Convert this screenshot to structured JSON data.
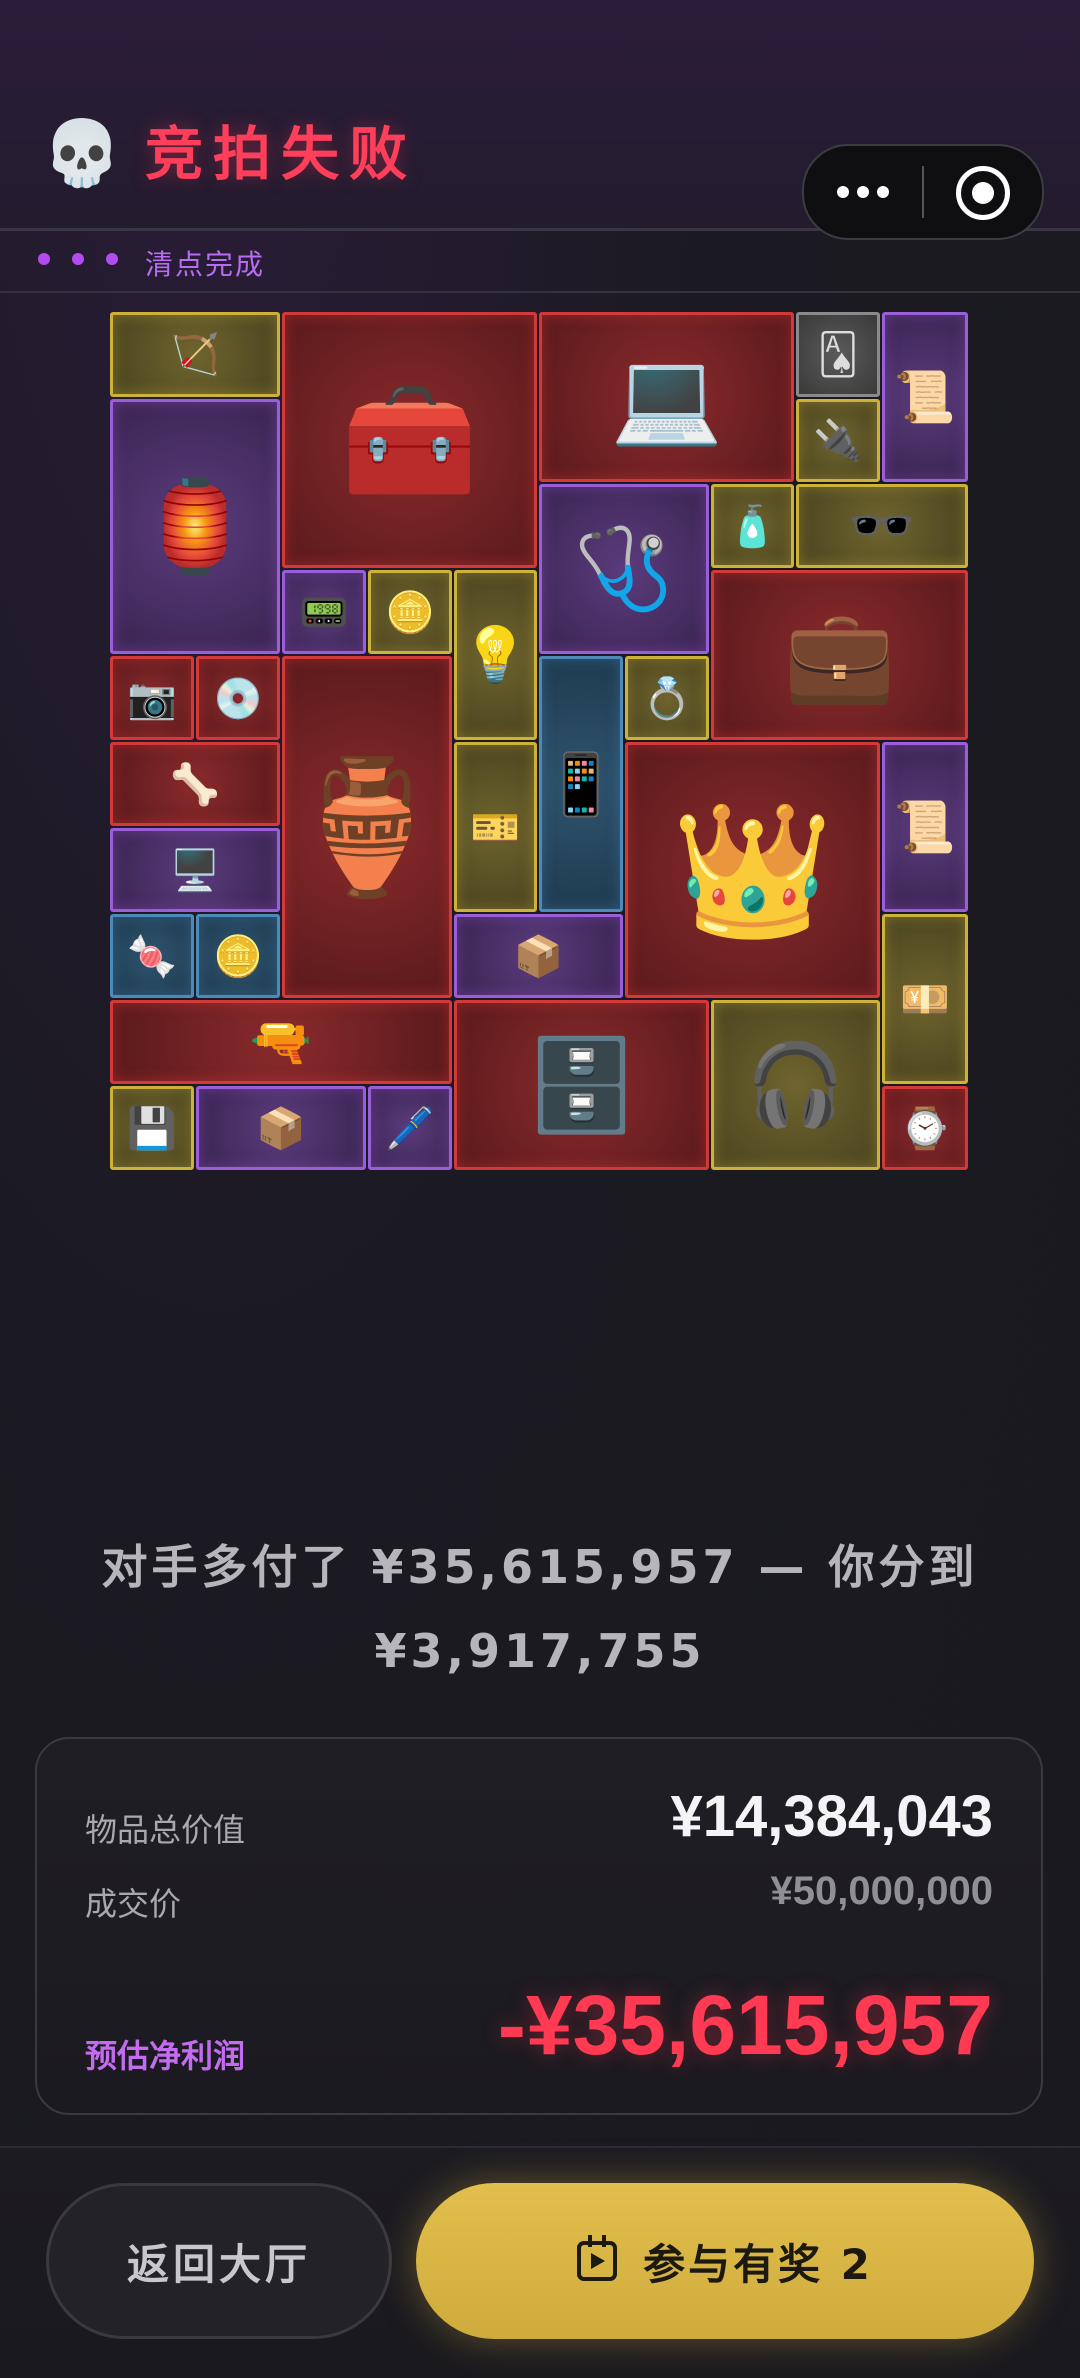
{
  "header": {
    "title": "竞拍失败",
    "skull_icon": "💀"
  },
  "status": {
    "text": "清点完成"
  },
  "items": [
    {
      "name": "crossbow",
      "icon": "🏹",
      "rarity": "yellow"
    },
    {
      "name": "equipment-case",
      "icon": "🧰",
      "rarity": "red"
    },
    {
      "name": "laptop",
      "icon": "💻",
      "rarity": "red"
    },
    {
      "name": "playing-card",
      "icon": "🂡",
      "rarity": "gray"
    },
    {
      "name": "old-book",
      "icon": "📜",
      "rarity": "purple"
    },
    {
      "name": "lamp",
      "icon": "🏮",
      "rarity": "purple"
    },
    {
      "name": "usb-drive",
      "icon": "🔌",
      "rarity": "yellow"
    },
    {
      "name": "blood-pressure-monitor",
      "icon": "🩺",
      "rarity": "purple"
    },
    {
      "name": "inhaler",
      "icon": "🧴",
      "rarity": "yellow"
    },
    {
      "name": "sunglasses",
      "icon": "🕶️",
      "rarity": "yellow"
    },
    {
      "name": "walkie-talkie",
      "icon": "📟",
      "rarity": "purple"
    },
    {
      "name": "jewelry-box",
      "icon": "🪙",
      "rarity": "yellow"
    },
    {
      "name": "uv-lamp",
      "icon": "💡",
      "rarity": "yellow"
    },
    {
      "name": "rugged-laptop",
      "icon": "💼",
      "rarity": "red"
    },
    {
      "name": "camera-module",
      "icon": "📷",
      "rarity": "red"
    },
    {
      "name": "disc",
      "icon": "💿",
      "rarity": "red"
    },
    {
      "name": "vase",
      "icon": "🏺",
      "rarity": "red"
    },
    {
      "name": "phone-device",
      "icon": "📱",
      "rarity": "blue"
    },
    {
      "name": "gold-ring",
      "icon": "💍",
      "rarity": "yellow"
    },
    {
      "name": "crown",
      "icon": "👑",
      "rarity": "red"
    },
    {
      "name": "old-book-2",
      "icon": "📜",
      "rarity": "purple"
    },
    {
      "name": "claw",
      "icon": "🦴",
      "rarity": "red"
    },
    {
      "name": "tickets",
      "icon": "🎫",
      "rarity": "yellow"
    },
    {
      "name": "graphics-card",
      "icon": "🖥️",
      "rarity": "purple"
    },
    {
      "name": "banknotes",
      "icon": "💴",
      "rarity": "yellow"
    },
    {
      "name": "candy",
      "icon": "🍬",
      "rarity": "blue"
    },
    {
      "name": "coin",
      "icon": "🪙",
      "rarity": "blue"
    },
    {
      "name": "tape-box",
      "icon": "📦",
      "rarity": "purple"
    },
    {
      "name": "rifle",
      "icon": "🔫",
      "rarity": "red"
    },
    {
      "name": "nas-server",
      "icon": "🗄️",
      "rarity": "red"
    },
    {
      "name": "headset",
      "icon": "🎧",
      "rarity": "yellow"
    },
    {
      "name": "floppy-disk",
      "icon": "💾",
      "rarity": "yellow"
    },
    {
      "name": "tape-box-2",
      "icon": "📦",
      "rarity": "purple"
    },
    {
      "name": "pen",
      "icon": "🖊️",
      "rarity": "purple"
    },
    {
      "name": "gold-watch",
      "icon": "⌚",
      "rarity": "red"
    }
  ],
  "summary": {
    "line1": "对手多付了 ¥35,615,957 — 你分到",
    "line2": "¥3,917,755"
  },
  "card": {
    "total_label": "物品总价值",
    "total_value": "¥14,384,043",
    "deal_label": "成交价",
    "deal_value": "¥50,000,000",
    "profit_label": "预估净利润",
    "profit_value": "-¥35,615,957"
  },
  "buttons": {
    "back": "返回大厅",
    "join": "参与有奖 2"
  },
  "colors": {
    "accent_red": "#ff3a52",
    "accent_purple": "#c46cf0",
    "accent_gold": "#d6b446"
  }
}
